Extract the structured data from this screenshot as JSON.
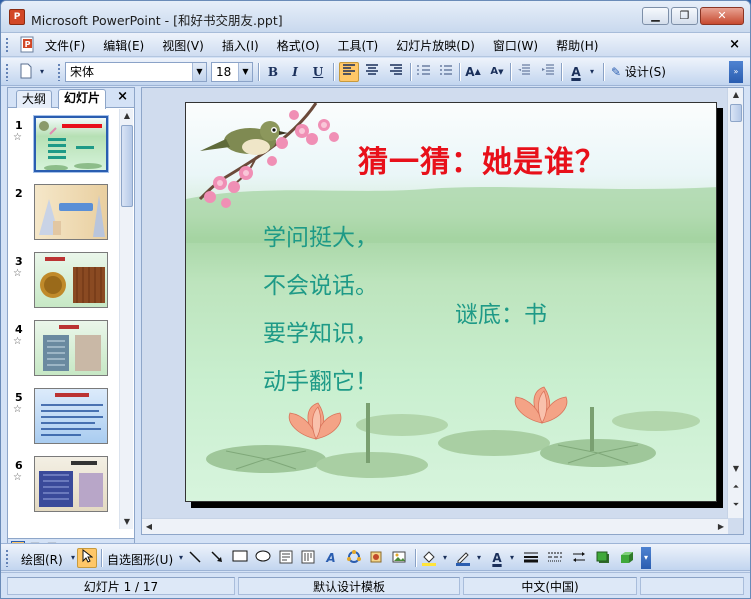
{
  "window": {
    "app_icon_text": "P",
    "title": "Microsoft PowerPoint - [和好书交朋友.ppt]",
    "minimize": "▁",
    "restore": "❐",
    "close": "✕"
  },
  "menu": {
    "items": [
      "文件(F)",
      "编辑(E)",
      "视图(V)",
      "插入(I)",
      "格式(O)",
      "工具(T)",
      "幻灯片放映(D)",
      "窗口(W)",
      "帮助(H)"
    ],
    "close": "×"
  },
  "toolbar": {
    "font_name": "宋体",
    "font_size": "18",
    "bold": "B",
    "italic": "I",
    "underline": "U",
    "design_label": "设计(S)"
  },
  "left_panel": {
    "tabs": [
      "大纲",
      "幻灯片"
    ],
    "close": "×",
    "thumbnails": [
      {
        "num": "1",
        "star": "☆"
      },
      {
        "num": "2",
        "star": ""
      },
      {
        "num": "3",
        "star": "☆"
      },
      {
        "num": "4",
        "star": "☆"
      },
      {
        "num": "5",
        "star": "☆"
      },
      {
        "num": "6",
        "star": "☆"
      }
    ]
  },
  "slide": {
    "title": "猜一猜：她是谁？",
    "lines": [
      "学问挺大，",
      "不会说话。",
      "要学知识，",
      "动手翻它！"
    ],
    "answer": "谜底：书"
  },
  "drawing_toolbar": {
    "draw_label": "绘图(R)",
    "autoshapes_label": "自选图形(U)"
  },
  "status": {
    "slide_counter": "幻灯片 1 / 17",
    "template": "默认设计模板",
    "language": "中文(中国)"
  },
  "colors": {
    "title_red": "#e8101a",
    "body_teal": "#1e9a87",
    "accent_blue": "#2a5db0"
  }
}
